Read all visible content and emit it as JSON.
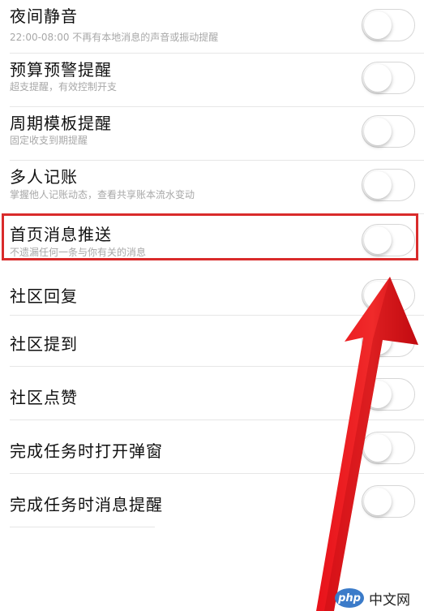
{
  "settings": [
    {
      "title": "夜间静音",
      "subtitle": "22:00-08:00 不再有本地消息的声音或振动提醒",
      "enabled": false
    },
    {
      "title": "预算预警提醒",
      "subtitle": "超支提醒，有效控制开支",
      "enabled": false
    },
    {
      "title": "周期模板提醒",
      "subtitle": "固定收支到期提醒",
      "enabled": false
    },
    {
      "title": "多人记账",
      "subtitle": "掌握他人记账动态，查看共享账本流水变动",
      "enabled": false
    },
    {
      "title": "首页消息推送",
      "subtitle": "不遗漏任何一条与你有关的消息",
      "enabled": false
    },
    {
      "title": "社区回复",
      "enabled": false
    },
    {
      "title": "社区提到",
      "enabled": false
    },
    {
      "title": "社区点赞",
      "enabled": false
    },
    {
      "title": "完成任务时打开弹窗",
      "enabled": false
    },
    {
      "title": "完成任务时消息提醒",
      "enabled": false
    }
  ],
  "annotation": {
    "highlight_color": "#d92b2b",
    "arrow_color": "#e8121a"
  },
  "watermark": {
    "logo": "php",
    "text": "中文网"
  }
}
